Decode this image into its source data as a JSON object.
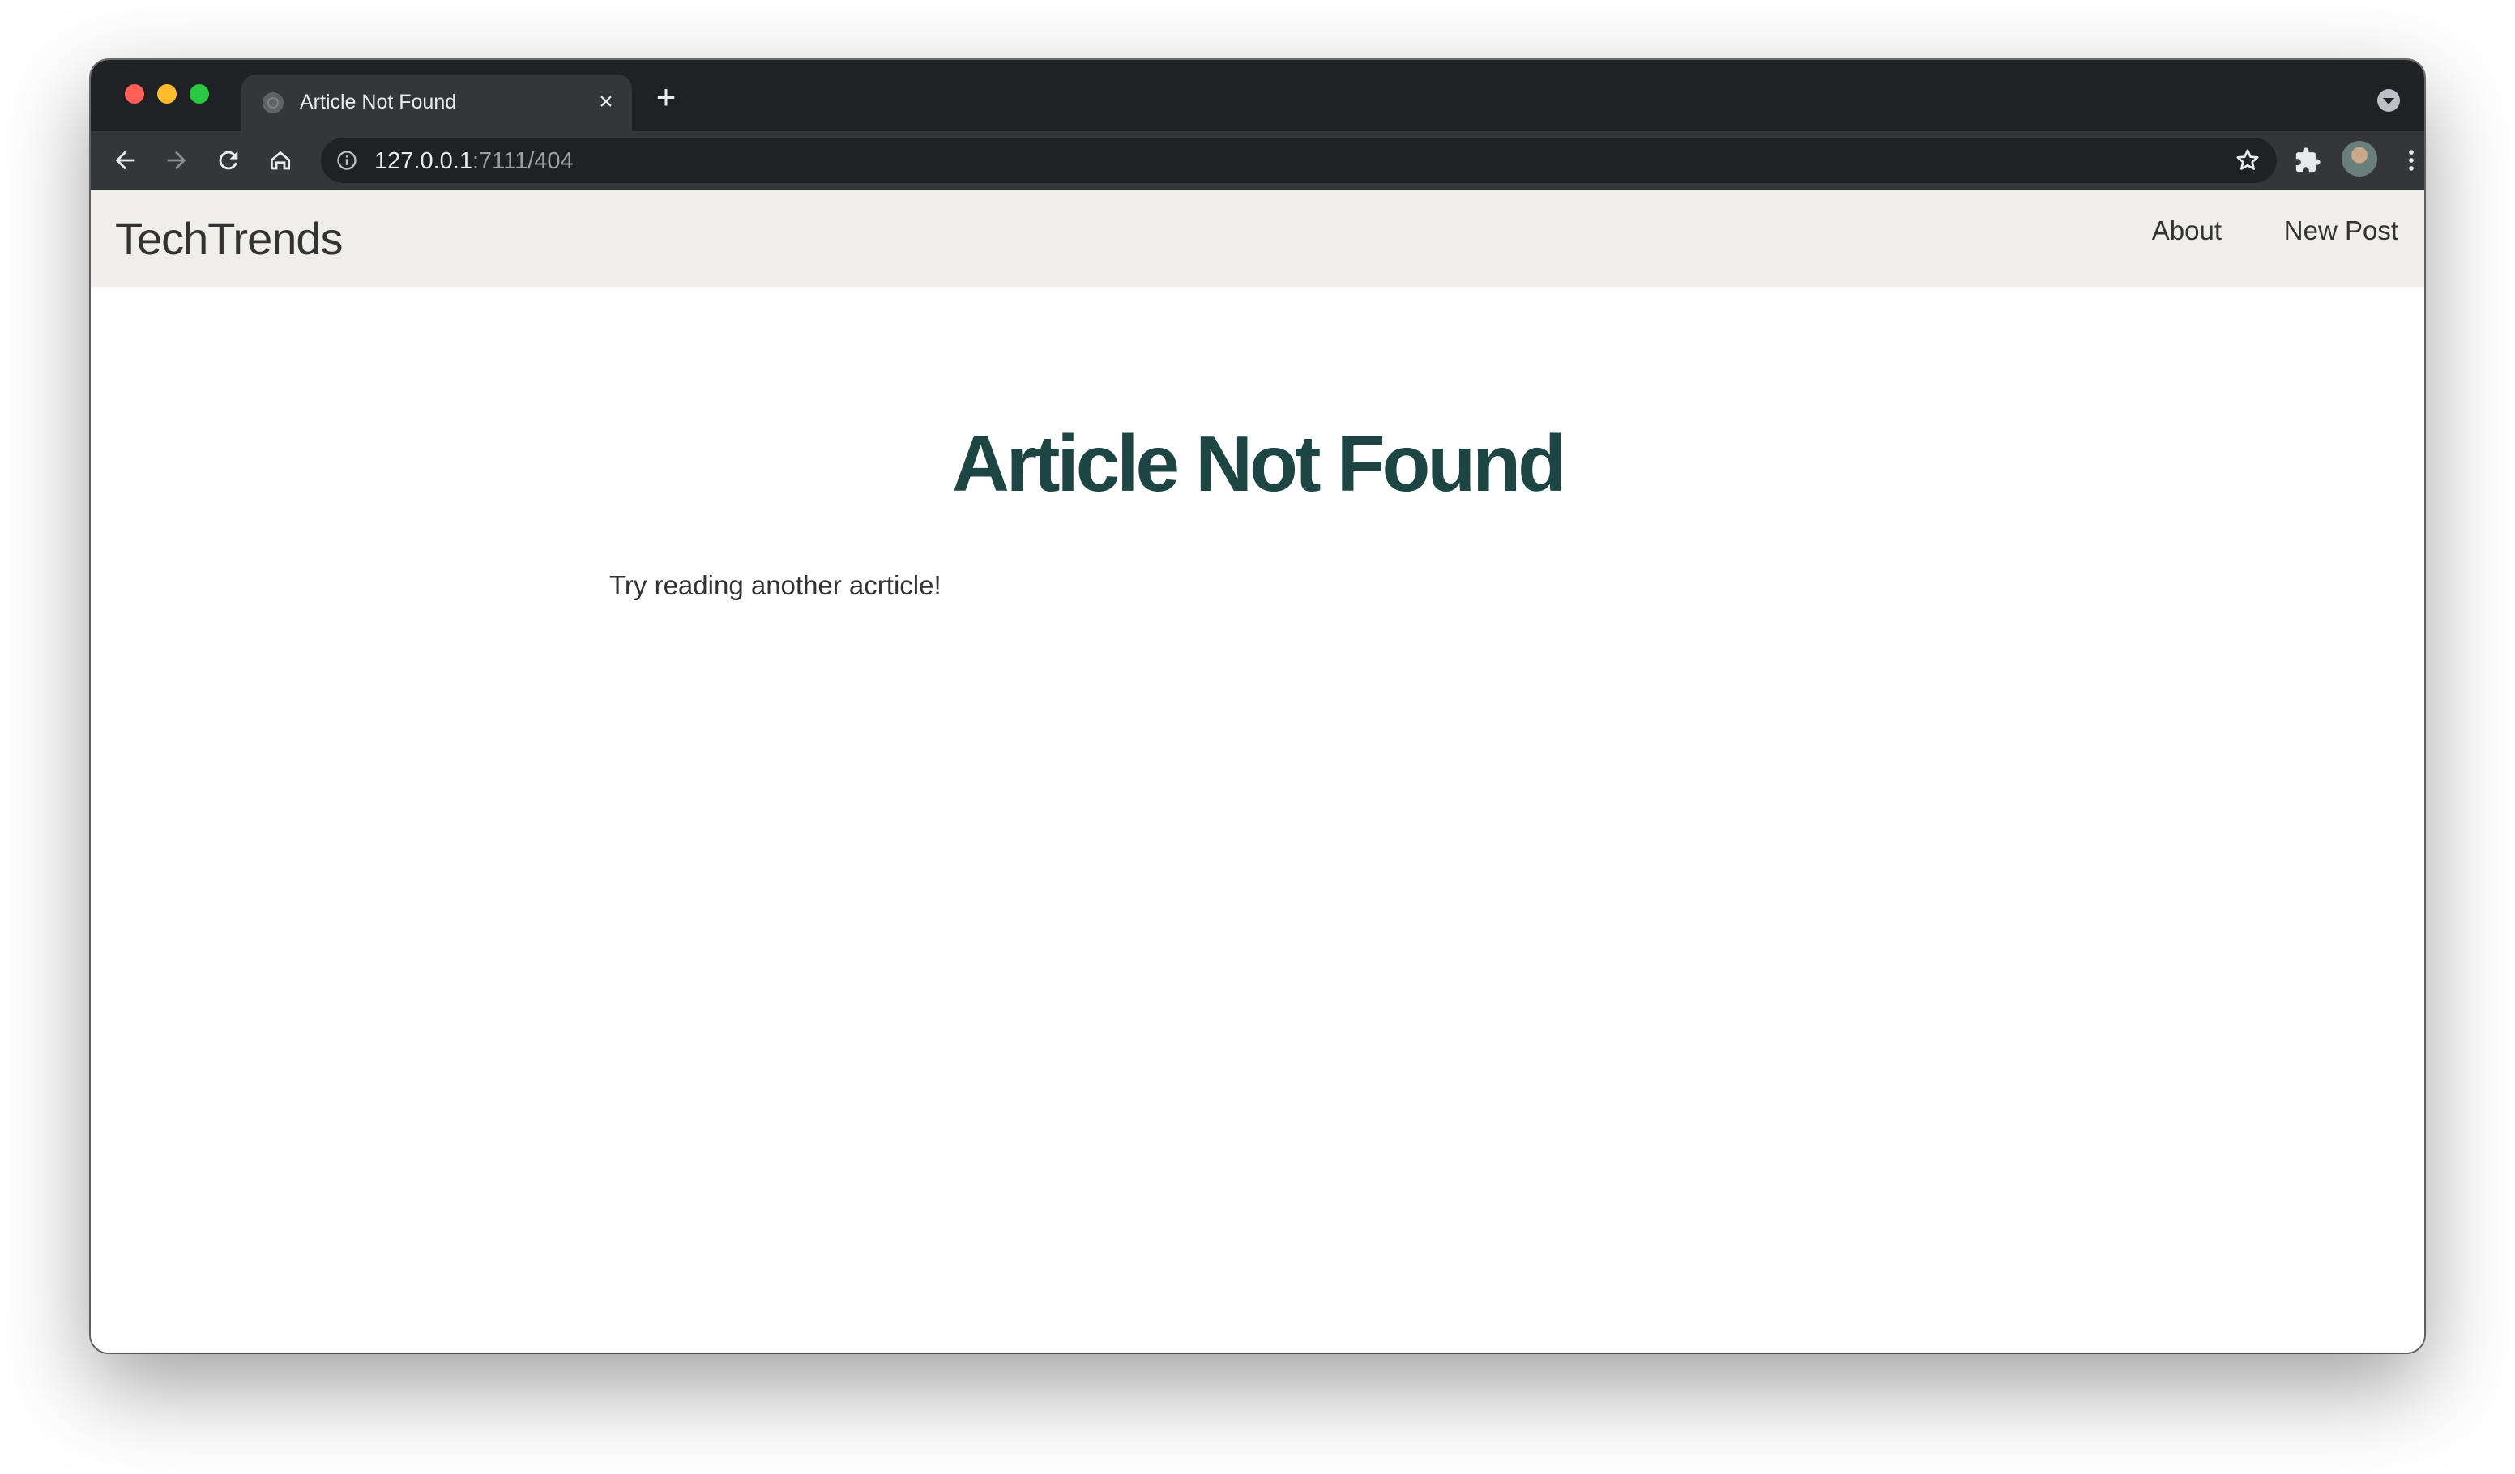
{
  "browser": {
    "tab": {
      "title": "Article Not Found",
      "close_glyph": "×",
      "new_tab_glyph": "+"
    },
    "address_bar": {
      "host": "127.0.0.1",
      "path": ":7111/404"
    },
    "icons": [
      "back-icon",
      "forward-icon",
      "reload-icon",
      "home-icon",
      "info-icon",
      "star-icon",
      "extensions-icon",
      "avatar",
      "menu-icon",
      "tab-search-icon"
    ]
  },
  "site": {
    "brand": "TechTrends",
    "nav": [
      {
        "label": "About"
      },
      {
        "label": "New Post"
      }
    ]
  },
  "main": {
    "heading": "Article Not Found",
    "message": "Try reading another acrticle!"
  },
  "colors": {
    "heading": "#1c4544",
    "navbar_bg": "#efeeeb",
    "text": "#333333",
    "chrome_dark": "#202124",
    "chrome_toolbar": "#35363a"
  }
}
